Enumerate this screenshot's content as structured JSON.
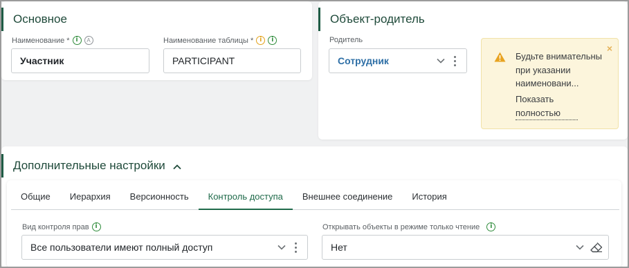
{
  "main": {
    "title": "Основное",
    "name_label": "Наименование *",
    "name_value": "Участник",
    "table_label": "Наименование таблицы *",
    "table_value": "PARTICIPANT",
    "a_badge": "A"
  },
  "parent": {
    "title": "Объект-родитель",
    "label": "Родитель",
    "value": "Сотрудник"
  },
  "warning": {
    "text": "Будьте внимательны при указании наименовани...",
    "link": "Показать полностью",
    "close": "×"
  },
  "additional": {
    "title": "Дополнительные настройки",
    "tabs": [
      {
        "label": "Общие"
      },
      {
        "label": "Иерархия"
      },
      {
        "label": "Версионность"
      },
      {
        "label": "Контроль доступа"
      },
      {
        "label": "Внешнее соединение"
      },
      {
        "label": "История"
      }
    ],
    "access_label": "Вид контроля прав",
    "access_value": "Все пользователи имеют полный доступ",
    "readonly_label": "Открывать объекты в режиме только чтение",
    "readonly_value": "Нет"
  },
  "colors": {
    "accent": "#1f6a4a",
    "info": "#2e8b3a",
    "warn": "#e3a21a",
    "link": "#2e6fa6"
  },
  "icons": [
    "info-icon",
    "autofill-icon",
    "warning-icon",
    "chevron-down-icon",
    "kebab-icon",
    "close-icon",
    "chevron-up-icon",
    "eraser-icon"
  ]
}
